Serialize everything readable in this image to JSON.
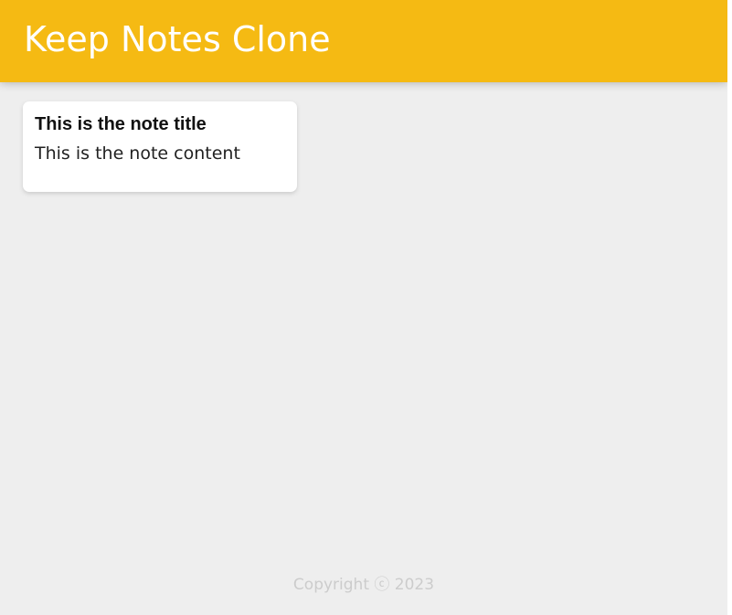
{
  "header": {
    "title": "Keep Notes Clone"
  },
  "notes": [
    {
      "title": "This is the note title",
      "content": "This is the note content"
    }
  ],
  "footer": {
    "copyright": "Copyright ⓒ 2023"
  },
  "colors": {
    "header_background": "#f5ba13",
    "page_background": "#eeeeee",
    "footer_text": "#cccccc"
  }
}
